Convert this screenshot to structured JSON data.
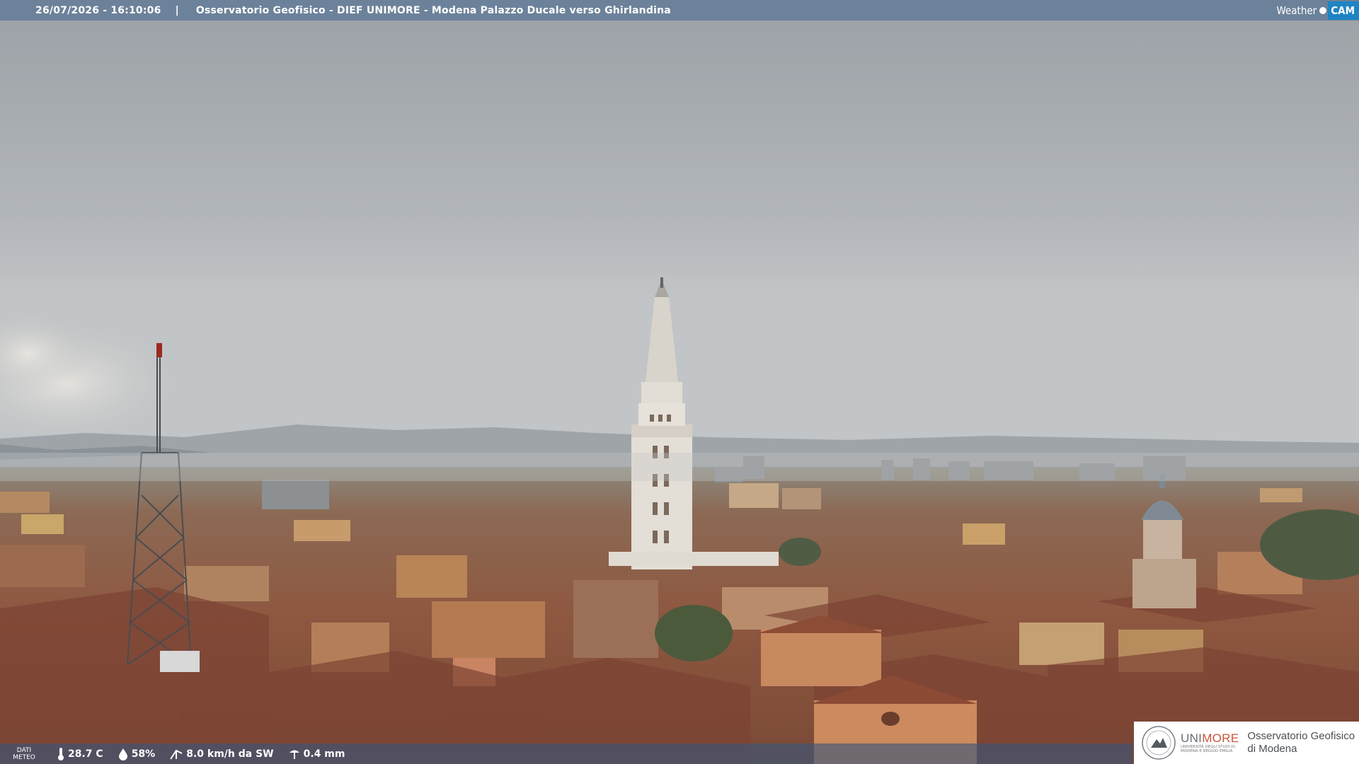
{
  "header": {
    "timestamp": "26/07/2026 - 16:10:06",
    "separator": "|",
    "title": "Osservatorio Geofisico - DIEF UNIMORE - Modena Palazzo Ducale verso Ghirlandina"
  },
  "brand": {
    "weather": "Weather",
    "cam": "CAM"
  },
  "meteo": {
    "label_line1": "DATI",
    "label_line2": "METEO",
    "temperature": "28.7 C",
    "humidity": "58%",
    "wind": "8.0 km/h da SW",
    "rain": "0.4 mm"
  },
  "partner": {
    "uni": "UNI",
    "more": "MORE",
    "sub": "UNIVERSITÀ DEGLI STUDI DI MODENA E REGGIO EMILIA",
    "obs_line1": "Osservatorio Geofisico",
    "obs_line2": "di Modena"
  },
  "colors": {
    "sky_top": "#a4aab0",
    "sky_horizon": "#c3c6c8",
    "roofs": "#9a5a40",
    "tower": "#e8e4dc",
    "brand_blue": "#1f84c4",
    "unimore_red": "#c8543a"
  },
  "icons": {
    "temperature": "thermometer-icon",
    "humidity": "drop-icon",
    "wind": "wind-icon",
    "rain": "rain-gauge-icon"
  }
}
